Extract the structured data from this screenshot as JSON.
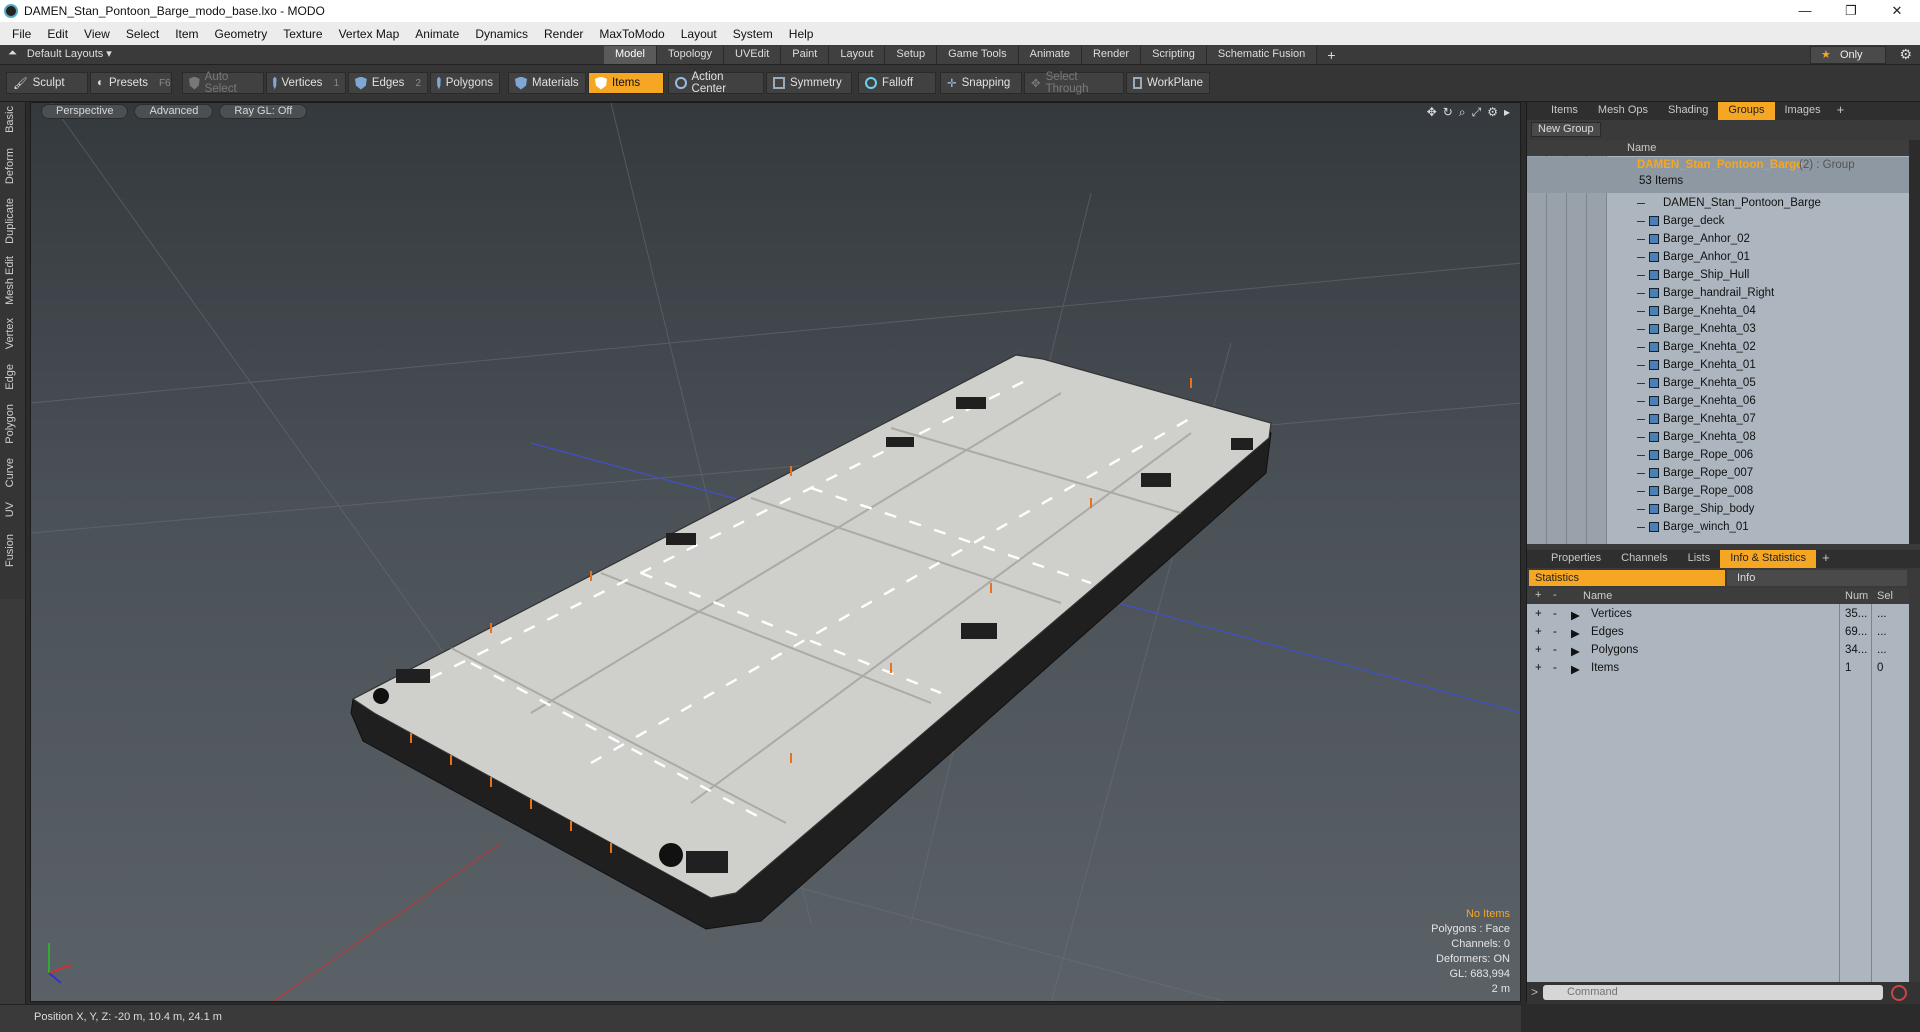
{
  "window": {
    "title": "DAMEN_Stan_Pontoon_Barge_modo_base.lxo - MODO",
    "minimize": "—",
    "maximize": "❐",
    "close": "✕"
  },
  "menu": [
    "File",
    "Edit",
    "View",
    "Select",
    "Item",
    "Geometry",
    "Texture",
    "Vertex Map",
    "Animate",
    "Dynamics",
    "Render",
    "MaxToModo",
    "Layout",
    "System",
    "Help"
  ],
  "layout": {
    "selector": "Default Layouts ▾",
    "tabs": [
      "Model",
      "Topology",
      "UVEdit",
      "Paint",
      "Layout",
      "Setup",
      "Game Tools",
      "Animate",
      "Render",
      "Scripting",
      "Schematic Fusion"
    ],
    "active_tab": "Model",
    "add_tab": "+",
    "only_label": "Only",
    "star": "★"
  },
  "toolbar": {
    "sculpt": "Sculpt",
    "presets": "Presets",
    "presets_key": "F6",
    "auto_select": "Auto Select",
    "vertices": "Vertices",
    "vertices_key": "1",
    "edges": "Edges",
    "edges_key": "2",
    "polygons": "Polygons",
    "materials": "Materials",
    "items": "Items",
    "action_center": "Action Center",
    "symmetry": "Symmetry",
    "falloff": "Falloff",
    "snapping": "Snapping",
    "select_through": "Select Through",
    "workplane": "WorkPlane"
  },
  "left_tabs": [
    "Basic",
    "Deform",
    "Duplicate",
    "Mesh Edit",
    "Vertex",
    "Edge",
    "Polygon",
    "Curve",
    "UV",
    "Fusion"
  ],
  "viewport": {
    "view_mode": "Perspective",
    "shading": "Advanced",
    "raygl": "Ray GL: Off",
    "info": {
      "no_items": "No Items",
      "polygons": "Polygons : Face",
      "channels": "Channels: 0",
      "deformers": "Deformers: ON",
      "gl": "GL: 683,994",
      "scale": "2 m"
    }
  },
  "groups_panel": {
    "tabs": [
      "Items",
      "Mesh Ops",
      "Shading",
      "Groups",
      "Images"
    ],
    "active": "Groups",
    "new_group": "New Group",
    "name_col": "Name",
    "group_name": "DAMEN_Stan_Pontoon_Barge",
    "group_suffix": "(2) : Group",
    "item_count": "53 Items",
    "items": [
      "DAMEN_Stan_Pontoon_Barge",
      "Barge_deck",
      "Barge_Anhor_02",
      "Barge_Anhor_01",
      "Barge_Ship_Hull",
      "Barge_handrail_Right",
      "Barge_Knehta_04",
      "Barge_Knehta_03",
      "Barge_Knehta_02",
      "Barge_Knehta_01",
      "Barge_Knehta_05",
      "Barge_Knehta_06",
      "Barge_Knehta_07",
      "Barge_Knehta_08",
      "Barge_Rope_006",
      "Barge_Rope_007",
      "Barge_Rope_008",
      "Barge_Ship_body",
      "Barge_winch_01"
    ]
  },
  "stats_panel": {
    "tabs": [
      "Properties",
      "Channels",
      "Lists",
      "Info & Statistics"
    ],
    "active": "Info & Statistics",
    "sub_tabs": [
      "Statistics",
      "Info"
    ],
    "columns": [
      "Name",
      "Num",
      "Sel"
    ],
    "rows": [
      {
        "name": "Vertices",
        "num": "35...",
        "sel": "..."
      },
      {
        "name": "Edges",
        "num": "69...",
        "sel": "..."
      },
      {
        "name": "Polygons",
        "num": "34...",
        "sel": "..."
      },
      {
        "name": "Items",
        "num": "1",
        "sel": "0"
      }
    ],
    "command_placeholder": "Command"
  },
  "status": {
    "position": "Position X, Y, Z:  -20 m, 10.4 m, 24.1 m"
  },
  "colors": {
    "accent": "#f5a623",
    "list_bg": "#adb6bf",
    "viewport_top": "#34393d"
  }
}
